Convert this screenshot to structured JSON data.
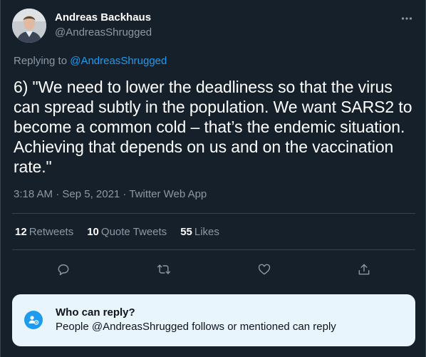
{
  "author": {
    "display_name": "Andreas Backhaus",
    "handle": "@AndreasShrugged"
  },
  "reply_context": {
    "prefix": "Replying to ",
    "handle": "@AndreasShrugged"
  },
  "tweet": {
    "text": "6) \"We need to lower the deadliness so that the virus can spread subtly in the population. We want SARS2 to become a common cold – that’s the endemic situation. Achieving that depends on us and on the vaccination rate.\"",
    "timestamp": "3:18 AM · Sep 5, 2021 · Twitter Web App"
  },
  "stats": [
    {
      "count": "12",
      "label": "Retweets"
    },
    {
      "count": "10",
      "label": "Quote Tweets"
    },
    {
      "count": "55",
      "label": "Likes"
    }
  ],
  "actions": {
    "icons": [
      "reply-icon",
      "retweet-icon",
      "like-icon",
      "share-icon"
    ]
  },
  "who_can_reply": {
    "title": "Who can reply?",
    "description": "People @AndreasShrugged follows or mentioned can reply"
  },
  "colors": {
    "background": "#15202b",
    "accent": "#1d9bf0",
    "secondary_text": "#8b98a5",
    "divider": "#38444d",
    "info_box": "#e8f5fd"
  }
}
